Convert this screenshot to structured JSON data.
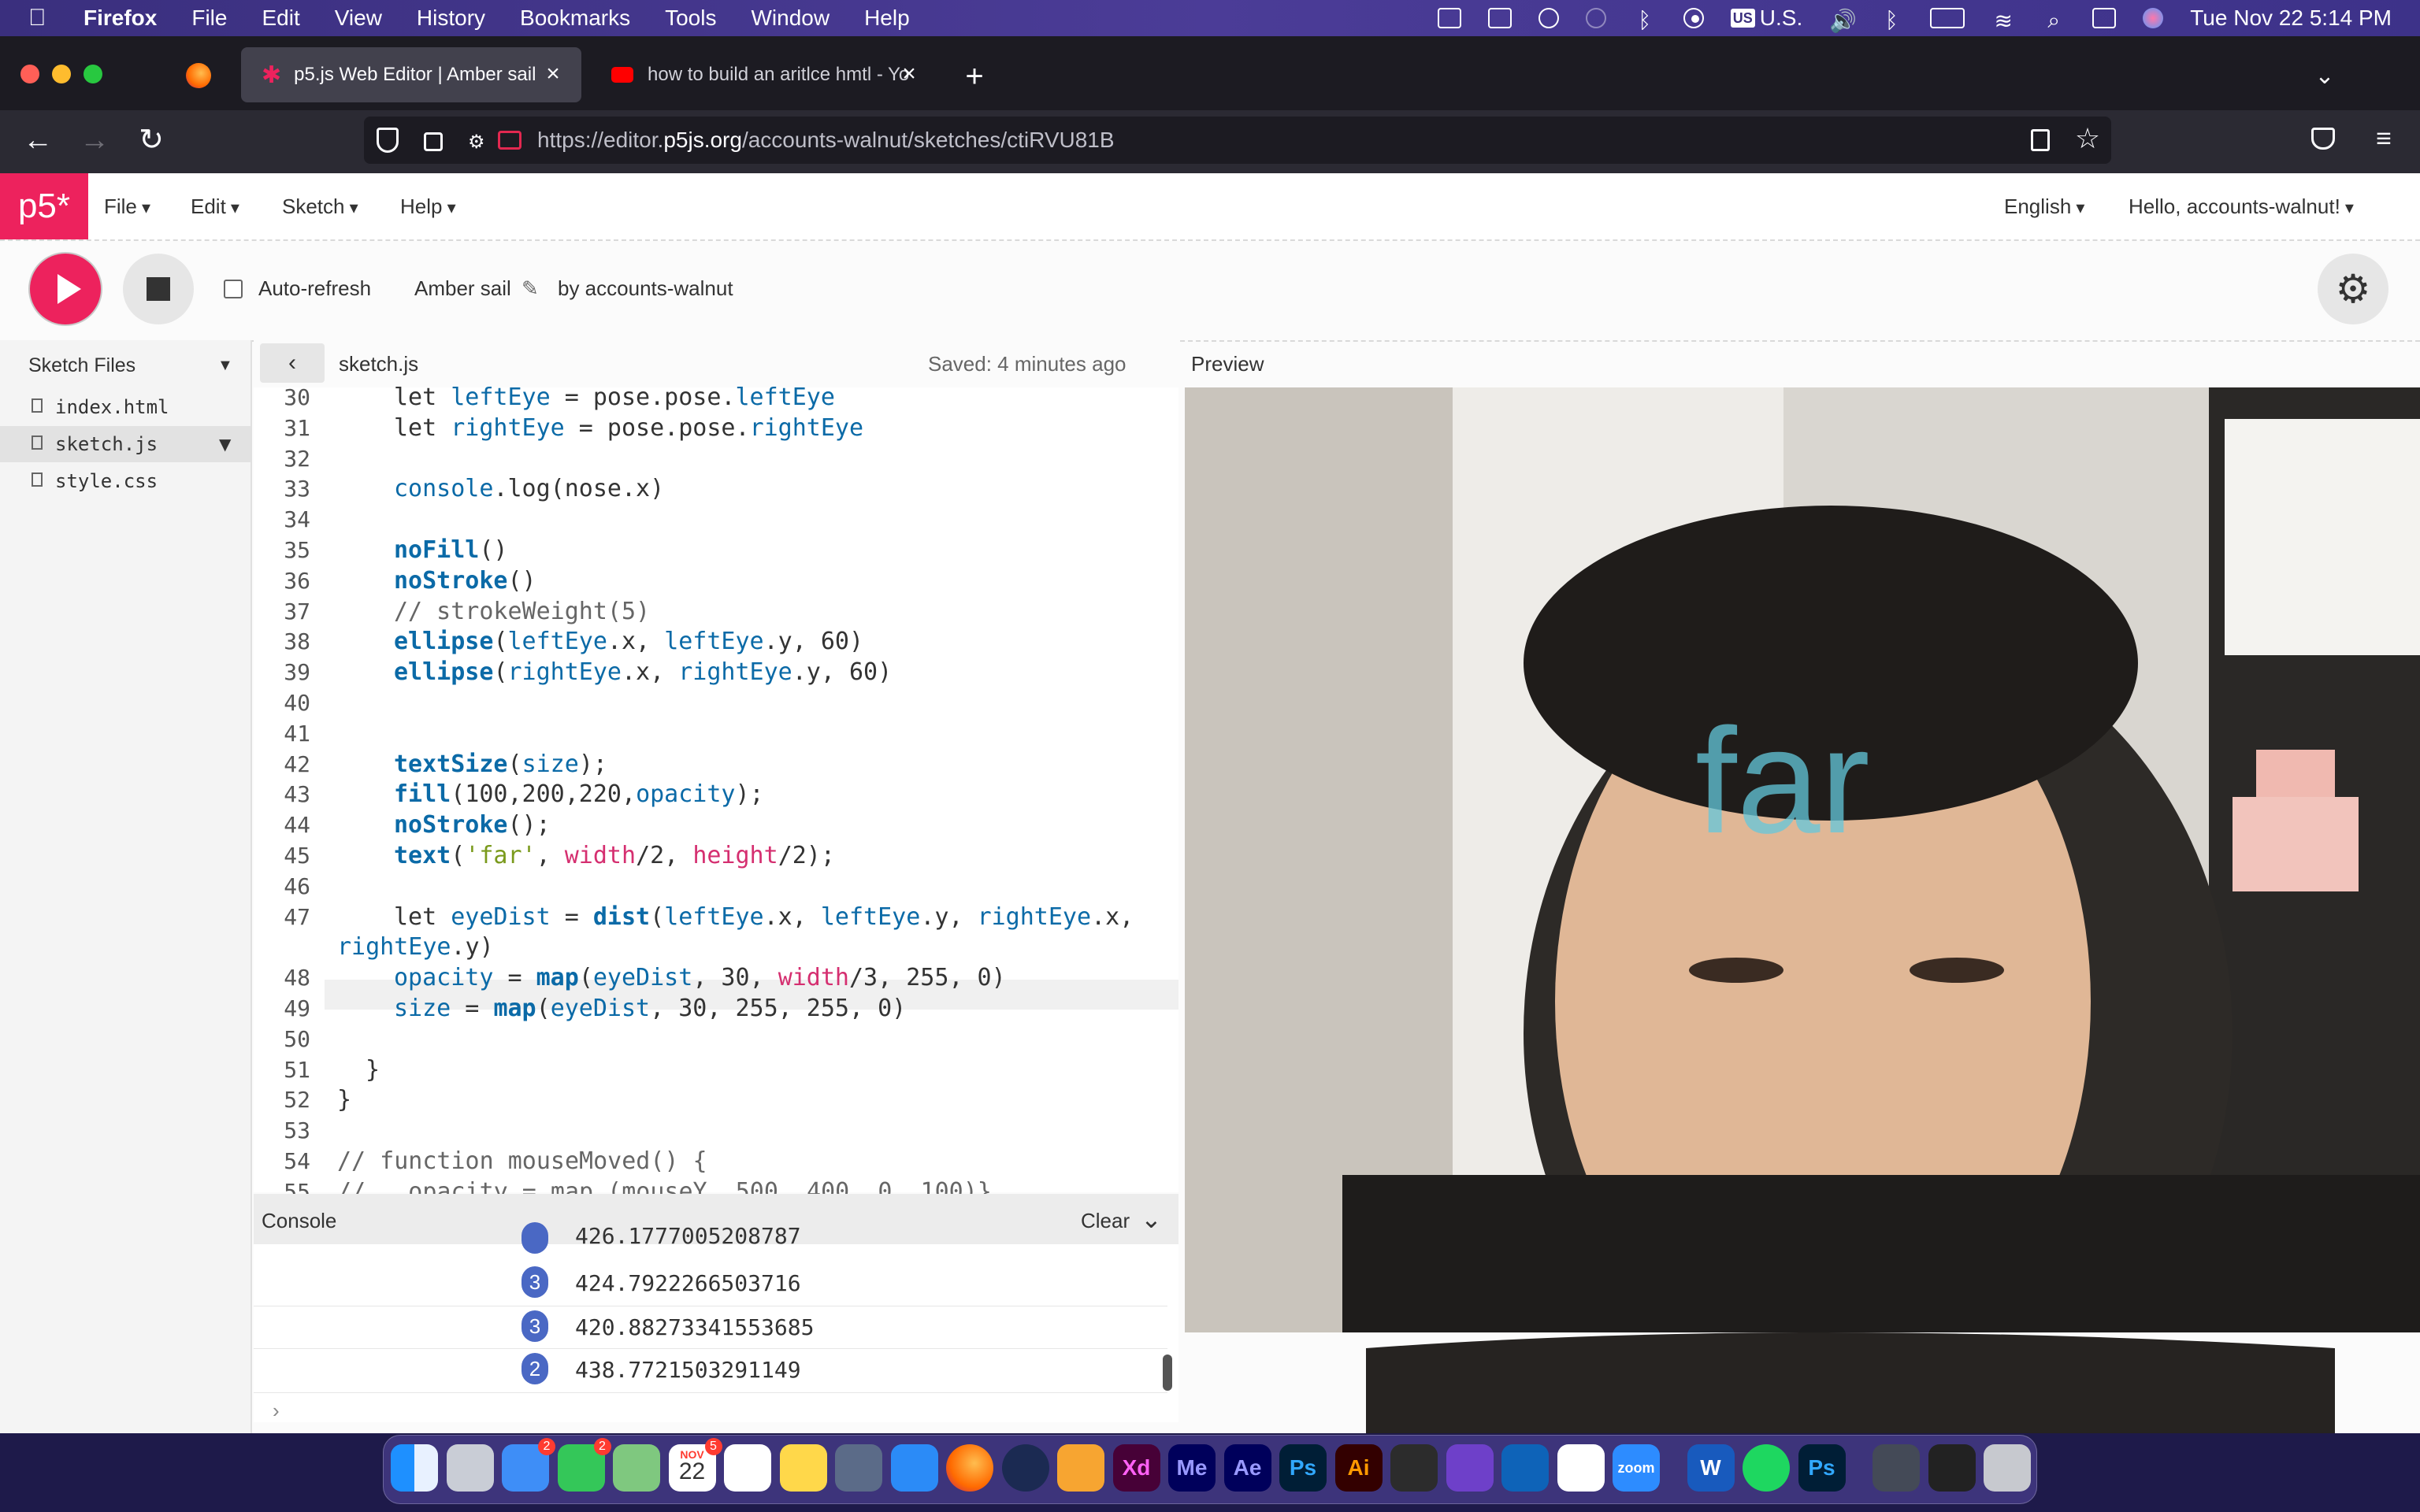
{
  "menubar": {
    "app": "Firefox",
    "menus": [
      "File",
      "Edit",
      "View",
      "History",
      "Bookmarks",
      "Tools",
      "Window",
      "Help"
    ],
    "input_source": "U.S.",
    "datetime": "Tue Nov 22  5:14 PM"
  },
  "browser": {
    "tabs": [
      {
        "title": "p5.js Web Editor | Amber sail",
        "active": true
      },
      {
        "title": "how to build an aritlce hmtl - Yo",
        "active": false
      }
    ],
    "url_prefix": "https://editor.",
    "url_domain": "p5js.org",
    "url_path": "/accounts-walnut/sketches/ctiRVU81B"
  },
  "p5": {
    "logo": "p5*",
    "menu": [
      "File",
      "Edit",
      "Sketch",
      "Help"
    ],
    "language": "English",
    "greeting": "Hello, accounts-walnut!",
    "auto_refresh_label": "Auto-refresh",
    "sketch_name": "Amber sail",
    "byline": "by accounts-walnut",
    "sidebar_title": "Sketch Files",
    "files": [
      "index.html",
      "sketch.js",
      "style.css"
    ],
    "selected_file": "sketch.js",
    "open_file": "sketch.js",
    "saved": "Saved: 4 minutes ago",
    "preview_label": "Preview",
    "preview_text": "far",
    "console_title": "Console",
    "console_clear": "Clear",
    "console_partial": "426.1777005208787",
    "console_rows": [
      {
        "count": "3",
        "value": "424.7922266503716"
      },
      {
        "count": "3",
        "value": "420.88273341553685"
      },
      {
        "count": "2",
        "value": "438.7721503291149"
      }
    ],
    "console_prompt": "›"
  },
  "code": {
    "line_numbers": [
      "30",
      "31",
      "32",
      "33",
      "34",
      "35",
      "36",
      "37",
      "38",
      "39",
      "40",
      "41",
      "42",
      "43",
      "44",
      "45",
      "46",
      "47",
      "",
      "48",
      "49",
      "50",
      "51",
      "52",
      "53",
      "54",
      "55"
    ],
    "lines": [
      "let leftEye = pose.pose.leftEye",
      "let rightEye = pose.pose.rightEye",
      "",
      "console.log(nose.x)",
      "",
      "noFill()",
      "noStroke()",
      "// strokeWeight(5)",
      "ellipse(leftEye.x, leftEye.y, 60)",
      "ellipse(rightEye.x, rightEye.y, 60)",
      "",
      "",
      "textSize(size);",
      "fill(100,200,220,opacity);",
      "noStroke();",
      "text('far', width/2, height/2);",
      "",
      "let eyeDist = dist(leftEye.x, leftEye.y, rightEye.x,",
      "rightEye.y)",
      "opacity = map(eyeDist, 30, width/3, 255, 0)",
      "size = map(eyeDist, 30, 255, 255, 0)",
      "",
      "}",
      "}",
      "",
      "// function mouseMoved() {",
      "//   opacity = map (mouseY, 500, 400, 0, 100)}"
    ]
  },
  "dock": {
    "apps": [
      "Finder",
      "Launchpad",
      "Mail",
      "Messages",
      "Maps",
      "Calendar",
      "Reminders",
      "Notes",
      "QuickTime",
      "Safari",
      "Firefox",
      "Cinema 4D",
      "Pages",
      "Xd",
      "Me",
      "Ae",
      "Ps",
      "Ai",
      "Figma",
      "GitHub Desktop",
      "VS Code",
      "Slack",
      "Zoom",
      "Word",
      "Spotify",
      "Ps",
      "Finder Window",
      "Terminal",
      "Trash"
    ],
    "labels": {
      "xd": "Xd",
      "me": "Me",
      "ae": "Ae",
      "ps": "Ps",
      "ai": "Ai",
      "w": "W",
      "zoom": "zoom",
      "cal_month": "NOV",
      "cal_day": "22"
    },
    "badges": {
      "mail": "2",
      "messages": "2",
      "calendar": "5"
    }
  },
  "colors": {
    "p5_pink": "#ed225d",
    "keyword_blue": "#0b6aa7",
    "global_pink": "#d52f70",
    "string_green": "#7a9a1c",
    "console_badge": "#4a68c4",
    "overlay_text": "#64c8dc"
  }
}
